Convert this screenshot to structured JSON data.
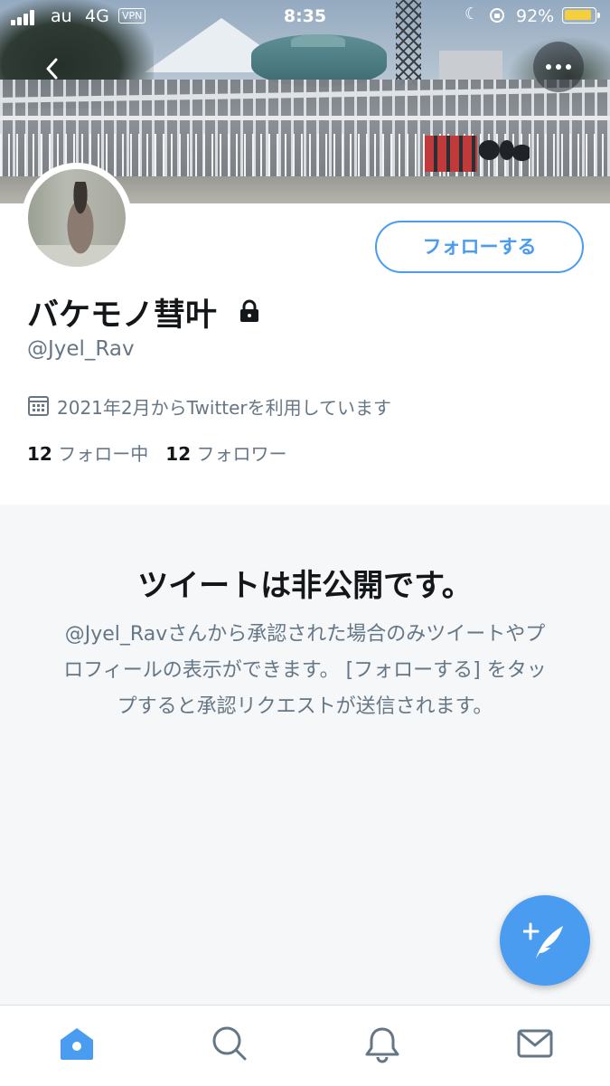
{
  "status_bar": {
    "carrier": "au",
    "network": "4G",
    "vpn": "VPN",
    "time": "8:35",
    "battery_percent": "92%",
    "battery_level": 0.92,
    "icons": [
      "signal-icon",
      "moon-icon",
      "rotation-lock-icon",
      "battery-icon"
    ]
  },
  "header": {
    "back_icon": "chevron-left-icon",
    "more_icon": "more-horizontal-icon"
  },
  "profile": {
    "display_name": "バケモノ彗叶",
    "protected_icon": "lock-icon",
    "handle": "@Jyel_Rav",
    "joined": "2021年2月からTwitterを利用しています",
    "following_count": "12",
    "following_label": "フォロー中",
    "followers_count": "12",
    "followers_label": "フォロワー",
    "follow_button": "フォローする"
  },
  "private_notice": {
    "title": "ツイートは非公開です。",
    "description": "@Jyel_Ravさんから承認された場合のみツイートやプロフィールの表示ができます。 [フォローする] をタップすると承認リクエストが送信されます。"
  },
  "fab": {
    "icon": "compose-tweet-icon"
  },
  "tab_bar": {
    "tabs": [
      {
        "icon": "home-icon",
        "active": true
      },
      {
        "icon": "search-icon",
        "active": false
      },
      {
        "icon": "notifications-icon",
        "active": false
      },
      {
        "icon": "messages-icon",
        "active": false
      }
    ]
  },
  "colors": {
    "accent": "#4a9cf0",
    "secondary_text": "#657786",
    "primary_text": "#14171a",
    "battery": "#f6cf3e"
  }
}
